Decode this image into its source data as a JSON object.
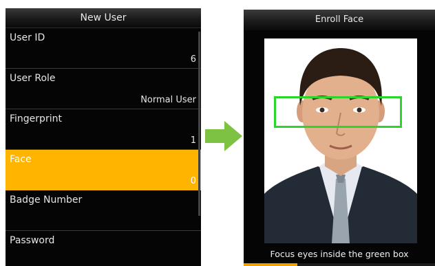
{
  "new_user_screen": {
    "title": "New User",
    "items": [
      {
        "label": "User ID",
        "value": "6"
      },
      {
        "label": "User Role",
        "value": "Normal User"
      },
      {
        "label": "Fingerprint",
        "value": "1"
      },
      {
        "label": "Face",
        "value": "0"
      },
      {
        "label": "Badge Number",
        "value": ""
      },
      {
        "label": "Password",
        "value": ""
      }
    ],
    "selected_item": "Face",
    "highlight_color": "#ffb400"
  },
  "arrow": {
    "icon": "arrow-right-icon",
    "color": "#7dc243"
  },
  "enroll_face_screen": {
    "title": "Enroll Face",
    "hint": "Focus eyes inside the green box",
    "face_box_color": "#2bd62b",
    "progress_fraction": 0.28,
    "progress_color": "#f0a000"
  }
}
